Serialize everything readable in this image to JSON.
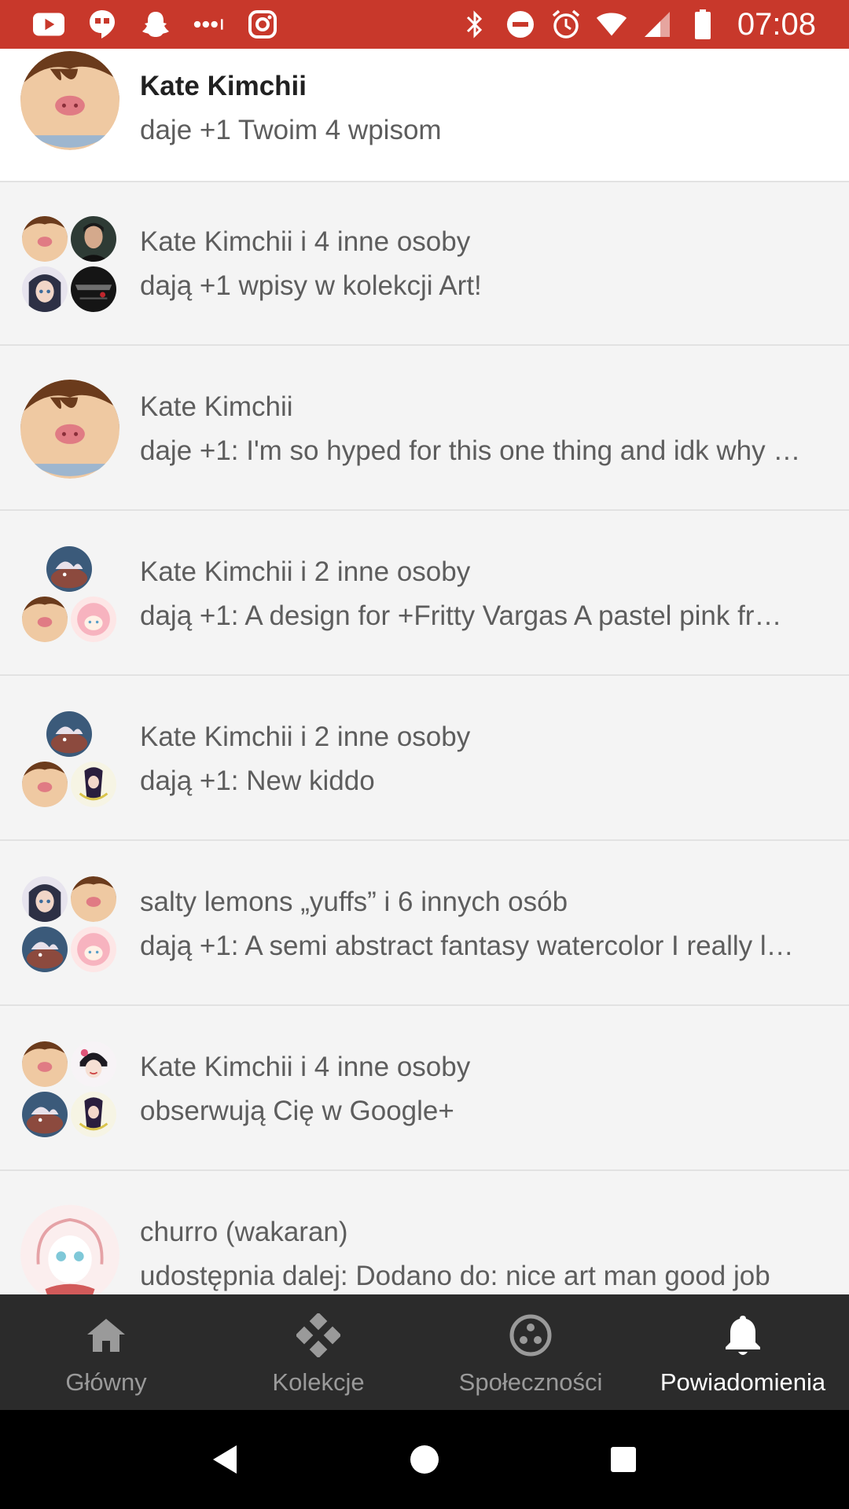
{
  "status_bar": {
    "time": "07:08",
    "left_icons": [
      "youtube-icon",
      "hangouts-icon",
      "snapchat-icon",
      "more-notifications-icon",
      "instagram-icon"
    ],
    "right_icons": [
      "bluetooth-icon",
      "do-not-disturb-icon",
      "alarm-icon",
      "wifi-icon",
      "signal-icon",
      "battery-icon"
    ],
    "color": "#c8382b"
  },
  "notifications": [
    {
      "title": "Kate Kimchii",
      "text": "daje +1 Twoim 4 wpisom",
      "unread": true,
      "avatars": [
        "pig"
      ]
    },
    {
      "title": "Kate Kimchii i 4 inne osoby",
      "text": "dają +1 wpisy w kolekcji Art!",
      "unread": false,
      "avatars": [
        "pig",
        "man",
        "anime-girl",
        "dark-art"
      ]
    },
    {
      "title": "Kate Kimchii",
      "text": "daje +1: I'm so hyped for this one thing and idk why …",
      "unread": false,
      "avatars": [
        "pig"
      ]
    },
    {
      "title": "Kate Kimchii i 2 inne osoby",
      "text": "dają +1: A design for +Fritty Vargas A pastel pink fr…",
      "unread": false,
      "avatars": [
        "boar",
        "pig",
        "pink-girl"
      ]
    },
    {
      "title": "Kate Kimchii i 2 inne osoby",
      "text": "dają +1: New kiddo",
      "unread": false,
      "avatars": [
        "boar",
        "pig",
        "witch"
      ]
    },
    {
      "title": "salty lemons „yuffs” i 6 innych osób",
      "text": "dają +1: A semi abstract fantasy watercolor I really l…",
      "unread": false,
      "avatars": [
        "anime-girl",
        "pig",
        "boar",
        "pink-girl"
      ]
    },
    {
      "title": "Kate Kimchii i 4 inne osoby",
      "text": "obserwują Cię w Google+",
      "unread": false,
      "avatars": [
        "pig",
        "dark-hair-girl",
        "boar",
        "witch"
      ]
    },
    {
      "title": "churro (wakaran)",
      "text": "udostępnia dalej: Dodano do: nice art man good job",
      "unread": false,
      "avatars": [
        "sketch-girl"
      ]
    }
  ],
  "bottom_nav": {
    "items": [
      {
        "label": "Główny",
        "icon": "home-icon",
        "active": false
      },
      {
        "label": "Kolekcje",
        "icon": "collections-icon",
        "active": false
      },
      {
        "label": "Społeczności",
        "icon": "communities-icon",
        "active": false
      },
      {
        "label": "Powiadomienia",
        "icon": "bell-icon",
        "active": true
      }
    ]
  },
  "system_nav": [
    "back-icon",
    "home-circle-icon",
    "recents-icon"
  ]
}
